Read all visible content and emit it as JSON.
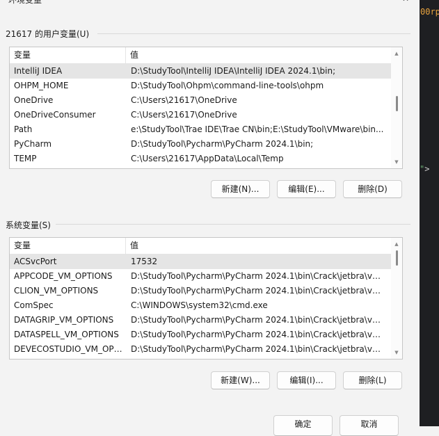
{
  "window": {
    "title_fragment": "环境变量",
    "close_glyph": "✕"
  },
  "user_group": {
    "label": "21617 的用户变量(U)",
    "headers": {
      "name": "变量",
      "value": "值"
    },
    "rows": [
      {
        "name": "IntelliJ IDEA",
        "value": "D:\\StudyTool\\IntelliJ IDEA\\IntelliJ IDEA 2024.1\\bin;",
        "selected": true
      },
      {
        "name": "OHPM_HOME",
        "value": "D:\\StudyTool\\Ohpm\\command-line-tools\\ohpm"
      },
      {
        "name": "OneDrive",
        "value": "C:\\Users\\21617\\OneDrive"
      },
      {
        "name": "OneDriveConsumer",
        "value": "C:\\Users\\21617\\OneDrive"
      },
      {
        "name": "Path",
        "value": "e:\\StudyTool\\Trae IDE\\Trae CN\\bin;E:\\StudyTool\\VMware\\bin..."
      },
      {
        "name": "PyCharm",
        "value": "D:\\StudyTool\\Pycharm\\PyCharm 2024.1\\bin;"
      },
      {
        "name": "TEMP",
        "value": "C:\\Users\\21617\\AppData\\Local\\Temp"
      }
    ],
    "scroll_fraction": 0.45,
    "buttons": {
      "new": "新建(N)...",
      "edit": "编辑(E)...",
      "delete": "删除(D)"
    }
  },
  "system_group": {
    "label": "系统变量(S)",
    "headers": {
      "name": "变量",
      "value": "值"
    },
    "rows": [
      {
        "name": "ACSvcPort",
        "value": "17532",
        "selected": true
      },
      {
        "name": "APPCODE_VM_OPTIONS",
        "value": "D:\\StudyTool\\Pycharm\\PyCharm 2024.1\\bin\\Crack\\jetbra\\vmo..."
      },
      {
        "name": "CLION_VM_OPTIONS",
        "value": "D:\\StudyTool\\Pycharm\\PyCharm 2024.1\\bin\\Crack\\jetbra\\vmo..."
      },
      {
        "name": "ComSpec",
        "value": "C:\\WINDOWS\\system32\\cmd.exe"
      },
      {
        "name": "DATAGRIP_VM_OPTIONS",
        "value": "D:\\StudyTool\\Pycharm\\PyCharm 2024.1\\bin\\Crack\\jetbra\\vmo..."
      },
      {
        "name": "DATASPELL_VM_OPTIONS",
        "value": "D:\\StudyTool\\Pycharm\\PyCharm 2024.1\\bin\\Crack\\jetbra\\vmo..."
      },
      {
        "name": "DEVECOSTUDIO_VM_OPT...",
        "value": "D:\\StudyTool\\Pycharm\\PyCharm 2024.1\\bin\\Crack\\jetbra\\vmo..."
      }
    ],
    "scroll_fraction": 0.0,
    "buttons": {
      "new": "新建(W)...",
      "edit": "编辑(I)...",
      "delete": "删除(L)"
    }
  },
  "footer": {
    "ok": "确定",
    "cancel": "取消"
  },
  "editor_fragments": {
    "line1": "00rp",
    "line2_quote": "\"",
    "line2_tag": ">"
  }
}
